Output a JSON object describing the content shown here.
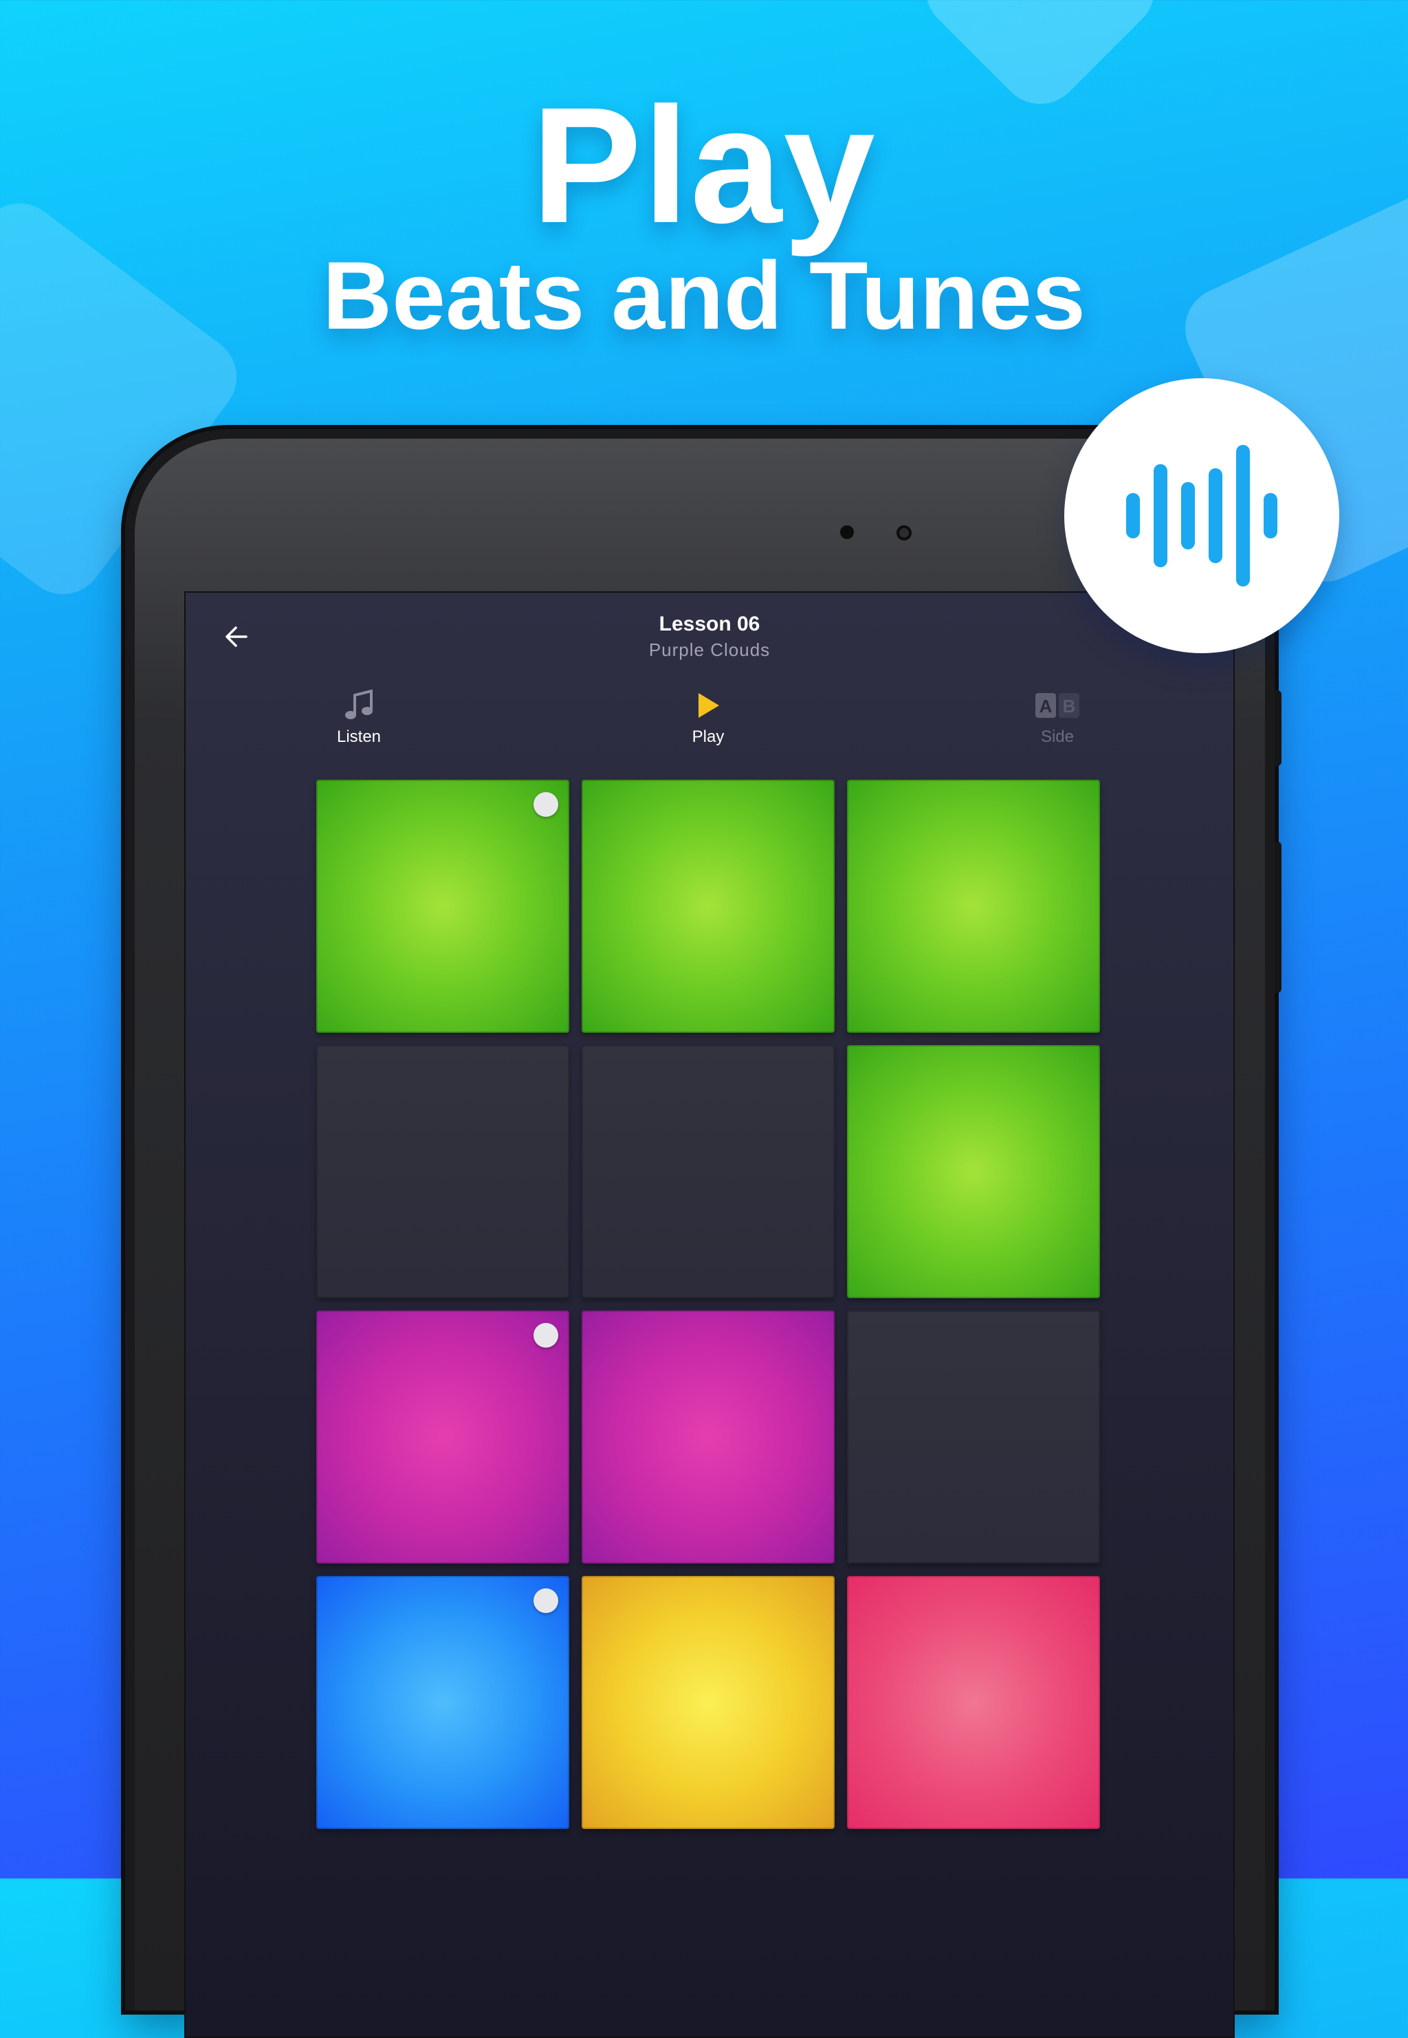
{
  "headline": {
    "main": "Play",
    "sub": "Beats and Tunes"
  },
  "app": {
    "lesson_title": "Lesson 06",
    "lesson_subtitle": "Purple Clouds",
    "back_icon": "arrow-left-icon",
    "tabs": [
      {
        "label": "Listen",
        "icon": "music-note-icon",
        "state": "inactive"
      },
      {
        "label": "Play",
        "icon": "play-icon",
        "state": "active"
      },
      {
        "label": "Side",
        "icon": "ab-side-icon",
        "state": "disabled"
      }
    ],
    "pads": [
      {
        "color": "green",
        "dot": true
      },
      {
        "color": "green",
        "dot": false
      },
      {
        "color": "green",
        "dot": false
      },
      {
        "color": "empty",
        "dot": false
      },
      {
        "color": "empty",
        "dot": false
      },
      {
        "color": "green",
        "dot": false
      },
      {
        "color": "magenta",
        "dot": true
      },
      {
        "color": "magenta",
        "dot": false
      },
      {
        "color": "empty",
        "dot": false
      },
      {
        "color": "blue",
        "dot": true
      },
      {
        "color": "yellow",
        "dot": false
      },
      {
        "color": "pink",
        "dot": false
      }
    ]
  },
  "colors": {
    "accent_play": "#f6c21c",
    "badge_bars": "#1ba8f0",
    "pad_green": "#7ed321",
    "pad_magenta": "#d12fb3",
    "pad_blue": "#1a8cff",
    "pad_yellow": "#f3cf2c",
    "pad_pink": "#ec3f74",
    "pad_empty": "#30303f"
  },
  "badge_icon": "sound-wave-icon"
}
